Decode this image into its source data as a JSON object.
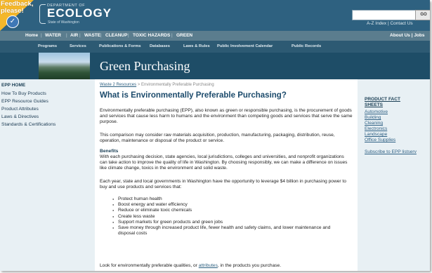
{
  "feedback": {
    "text": "Feedback, please!"
  },
  "header": {
    "dept_line": "DEPARTMENT OF",
    "agency": "ECOLOGY",
    "state": "State of Washington",
    "go_label": "GO",
    "utility_links": "A-Z Index | Contact Us"
  },
  "nav_primary": {
    "items": [
      "Home",
      "WATER",
      "AIR",
      "WASTE",
      "CLEANUP",
      "TOXIC HAZARDS",
      "GREEN"
    ],
    "right": "About Us | Jobs"
  },
  "nav_secondary": {
    "items": [
      "Programs",
      "Services",
      "Publications & Forms",
      "Databases",
      "Laws & Rules",
      "Public Involvement Calendar",
      "Public Records"
    ]
  },
  "page_header": {
    "title": "Green Purchasing"
  },
  "left_nav": {
    "heading": "EPP HOME",
    "items": [
      "How To Buy Products",
      "EPP Resource Guides",
      "Product Attributes",
      "Laws & Directives",
      "Standards & Certifications"
    ]
  },
  "breadcrumb": {
    "link": "Waste 2 Resources",
    "sep": " > ",
    "current": "Environmentally Preferable Purchasing"
  },
  "main": {
    "title": "What is Environmentally Preferable Purchasing?",
    "p1": "Environmentally preferable purchasing (EPP), also known as green or responsible purchasing, is the procurement of goods and services that cause less harm to humans and the environment than competing goods and services that serve the same purpose.",
    "p2": "This comparison may consider raw materials acquisition, production, manufacturing, packaging, distribution, reuse, operation, maintenance or disposal of the product or service.",
    "benefits_heading": "Benefits",
    "p3": "With each purchasing decision, state agencies, local jurisdictions, colleges and universities, and nonprofit organizations can take action to improve the quality of life in Washington. By choosing responsibly, we can make a difference on issues like climate change, toxics in the environment and solid waste.",
    "p4": "Each year, state and local governments in Washington have the opportunity to leverage $4 billion in purchasing power to buy and use products and services that:",
    "bullets": [
      "Protect human health",
      "Boost energy and water efficiency",
      "Reduce or eliminate toxic chemicals",
      "Create less waste",
      "Support markets for green products and green jobs",
      "Save money through increased product life, fewer health and safety claims, and lower maintenance and disposal costs"
    ],
    "p5_before": "Look for environmentally preferable qualities, or ",
    "p5_link": "attributes",
    "p5_after": ", in the products you purchase."
  },
  "right_panel": {
    "heading_line1": "PRODUCT FACT",
    "heading_line2": "SHEETS",
    "items": [
      "Automotive",
      "Building",
      "Cleaning",
      "Electronics",
      "Landscape",
      "Office Supplies"
    ],
    "subscribe": "Subscribe to EPP listserv"
  },
  "colors": {
    "banner": "#2e6180",
    "nav_primary": "#5b7d8e",
    "nav_secondary": "#2d5a73",
    "title": "#1b4a6b",
    "link": "#2d6080",
    "side_panels": "#e8f0f4",
    "feedback": "#f4b72b"
  }
}
